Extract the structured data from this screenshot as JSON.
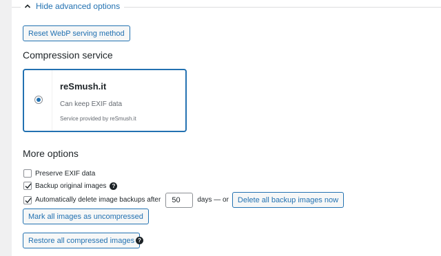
{
  "advanced": {
    "toggle_label": "Hide advanced options"
  },
  "reset_webp_label": "Reset WebP serving method",
  "compression": {
    "heading": "Compression service",
    "service_name": "reSmush.it",
    "service_desc": "Can keep EXIF data",
    "service_provider": "Service provided by reSmush.it",
    "selected": true
  },
  "more_options": {
    "heading": "More options",
    "preserve_exif": {
      "label": "Preserve EXIF data",
      "checked": false
    },
    "backup_original": {
      "label": "Backup original images",
      "checked": true
    },
    "auto_delete": {
      "label": "Automatically delete image backups after",
      "checked": true,
      "days_value": "50",
      "suffix": "days — or"
    },
    "delete_backups_label": "Delete all backup images now",
    "mark_uncompressed_label": "Mark all images as uncompressed",
    "restore_label": "Restore all compressed images"
  },
  "colors": {
    "accent": "#2271b1",
    "text": "#1d2327",
    "muted": "#646970"
  }
}
